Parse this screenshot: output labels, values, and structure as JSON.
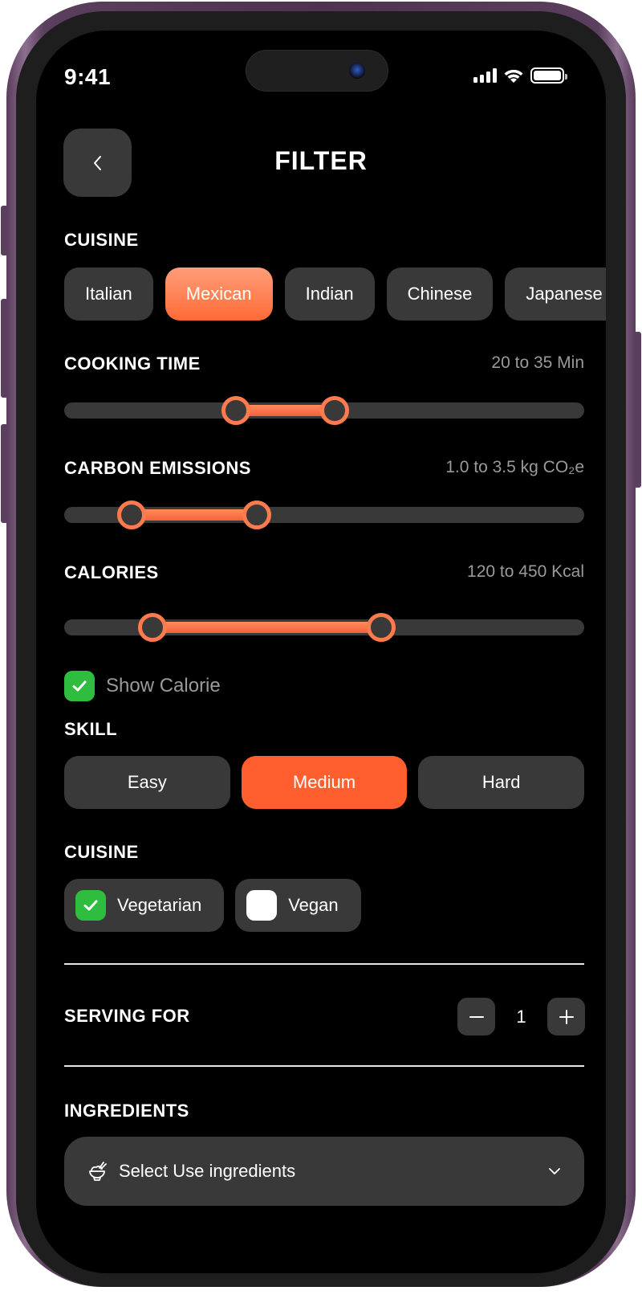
{
  "status_bar": {
    "time": "9:41",
    "icons": [
      "signal-icon",
      "wifi-icon",
      "battery-icon"
    ]
  },
  "header": {
    "title": "FILTER",
    "back_icon": "chevron-left-icon"
  },
  "cuisine": {
    "label": "CUISINE",
    "options": [
      {
        "label": "Italian",
        "selected": false
      },
      {
        "label": "Mexican",
        "selected": true
      },
      {
        "label": "Indian",
        "selected": false
      },
      {
        "label": "Chinese",
        "selected": false
      },
      {
        "label": "Japanese",
        "selected": false
      }
    ]
  },
  "cooking_time": {
    "label": "COOKING TIME",
    "value_text": "20 to 35 Min",
    "low_fraction": 0.33,
    "high_fraction": 0.52
  },
  "carbon_emissions": {
    "label": "CARBON EMISSIONS",
    "value_text": "1.0 to 3.5 kg CO₂e",
    "low_fraction": 0.13,
    "high_fraction": 0.37
  },
  "calories": {
    "label": "CALORIES",
    "value_text": "120 to 450 Kcal",
    "low_fraction": 0.17,
    "high_fraction": 0.61,
    "show_calorie": {
      "label": "Show Calorie",
      "checked": true
    }
  },
  "skill": {
    "label": "SKILL",
    "options": [
      {
        "label": "Easy",
        "selected": false
      },
      {
        "label": "Medium",
        "selected": true
      },
      {
        "label": "Hard",
        "selected": false
      }
    ]
  },
  "diet": {
    "label": "CUISINE",
    "options": [
      {
        "label": "Vegetarian",
        "checked": true
      },
      {
        "label": "Vegan",
        "checked": false
      }
    ]
  },
  "serving": {
    "label": "SERVING FOR",
    "value": "1",
    "decrement_icon": "minus-icon",
    "increment_icon": "plus-icon"
  },
  "ingredients": {
    "label": "INGREDIENTS",
    "placeholder": "Select Use ingredients",
    "icon": "rice-bowl-icon",
    "chevron": "chevron-down-icon"
  },
  "colors": {
    "accent": "#FF6A35",
    "track": "#393939",
    "check_green": "#2EBD3F",
    "background": "#000000"
  }
}
